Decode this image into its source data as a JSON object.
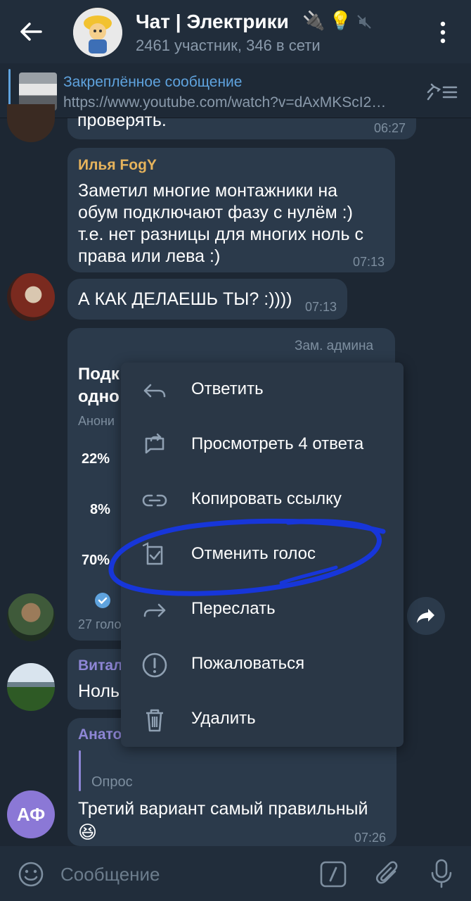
{
  "header": {
    "title": "Чат | Электрики",
    "title_emoji": "🔌💡",
    "subtitle": "2461 участник, 346 в сети"
  },
  "pinned": {
    "title": "Закреплённое сообщение",
    "text": "https://www.youtube.com/watch?v=dAxMKScI2…"
  },
  "messages": {
    "m1": {
      "text": "проверять.",
      "time": "06:27"
    },
    "m2": {
      "sender": "Илья FogY",
      "lines": [
        "Заметил многие монтажники на",
        "обум подключают фазу с нулём :)",
        "т.е. нет разницы для многих ноль с",
        "права или лева :)"
      ],
      "time": "07:13"
    },
    "m3": {
      "text": "А КАК ДЕЛАЕШЬ ТЫ? :))))",
      "time": "07:13"
    },
    "poll": {
      "badge": "Зам. админа",
      "question_1": "Подк",
      "question_2": "одно",
      "type": "Анони",
      "options": [
        {
          "percent": "22%"
        },
        {
          "percent": "8%"
        },
        {
          "percent": "70%"
        }
      ],
      "votes": "27 голо"
    },
    "m5": {
      "sender": "Витал",
      "text": "Ноль"
    },
    "m6": {
      "sender": "Анато",
      "reply_label": "Опрос",
      "text": "Третий вариант самый правильный",
      "emoji": "😆",
      "time": "07:26",
      "avatar_initials": "АФ"
    }
  },
  "context_menu": {
    "items": [
      {
        "label": "Ответить",
        "icon": "reply-icon"
      },
      {
        "label": "Просмотреть 4 ответа",
        "icon": "view-replies-icon"
      },
      {
        "label": "Копировать ссылку",
        "icon": "link-icon"
      },
      {
        "label": "Отменить голос",
        "icon": "retract-vote-icon"
      },
      {
        "label": "Переслать",
        "icon": "forward-icon"
      },
      {
        "label": "Пожаловаться",
        "icon": "report-icon"
      },
      {
        "label": "Удалить",
        "icon": "delete-icon"
      }
    ]
  },
  "input": {
    "placeholder": "Сообщение"
  },
  "colors": {
    "background": "#1d2733",
    "bubble": "#2b3a4b",
    "accent": "#5fa3de",
    "sender_gold": "#e6b35c",
    "sender_purple": "#8e86d6",
    "annotation": "#1736d9"
  }
}
